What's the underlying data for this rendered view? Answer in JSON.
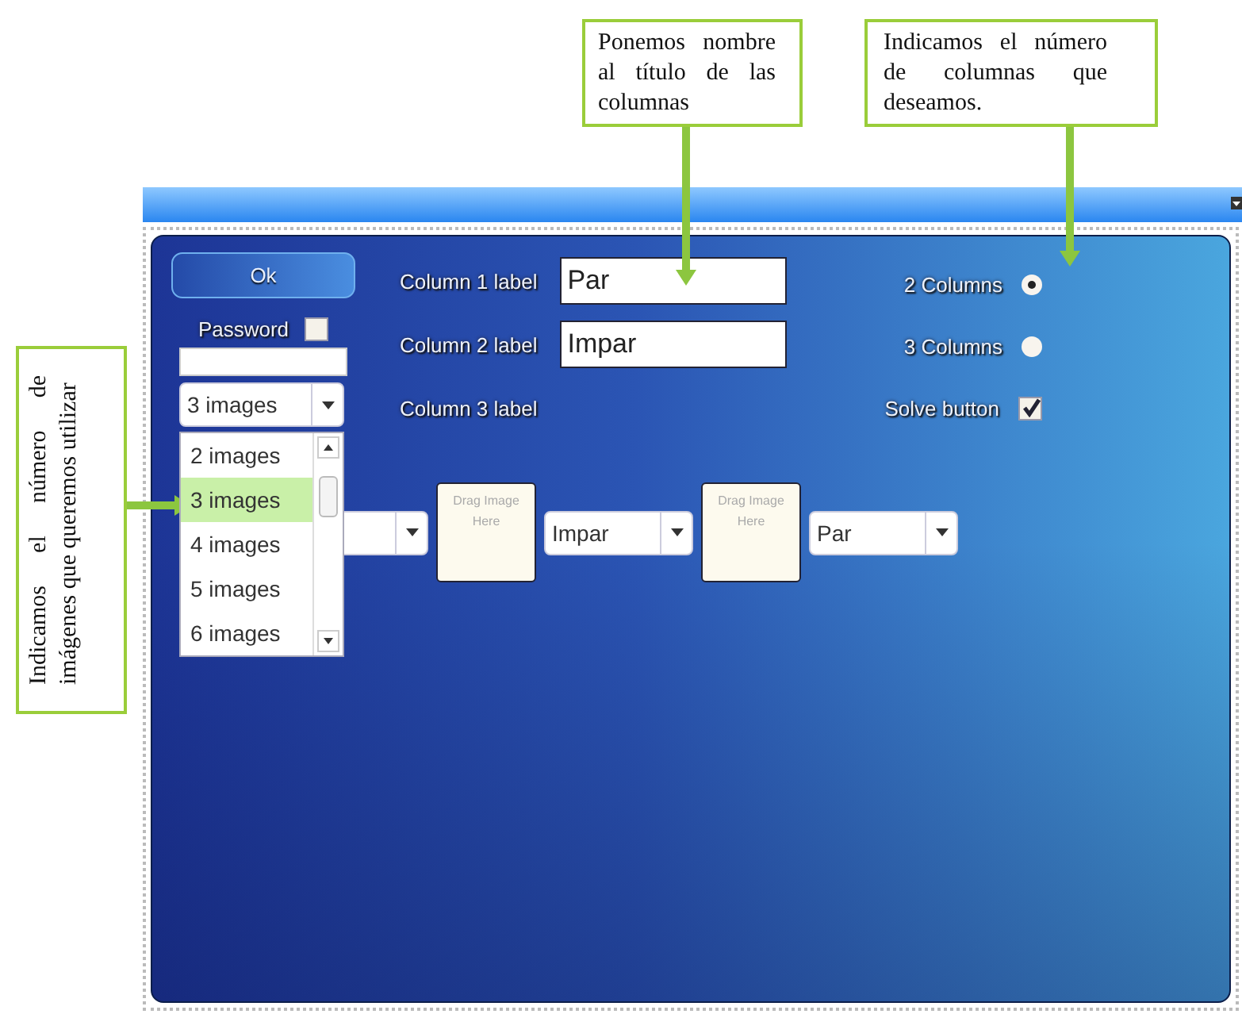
{
  "callouts": [
    {
      "text": "Ponemos nombre al título de las columnas"
    },
    {
      "text": "Indicamos el número de columnas que deseamos."
    },
    {
      "text": "Indicamos el número de imágenes que queremos utilizar"
    }
  ],
  "ok_button": "Ok",
  "password": {
    "label": "Password",
    "checked": false
  },
  "images_select": {
    "value": "3 images",
    "options": [
      {
        "label": "2 images",
        "selected": false
      },
      {
        "label": "3 images",
        "selected": true
      },
      {
        "label": "4 images",
        "selected": false
      },
      {
        "label": "5 images",
        "selected": false
      },
      {
        "label": "6 images",
        "selected": false
      }
    ]
  },
  "column_labels": [
    {
      "label": "Column 1 label",
      "value": "Par"
    },
    {
      "label": "Column 2 label",
      "value": "Impar"
    },
    {
      "label": "Column 3 label"
    }
  ],
  "column_options": [
    {
      "kind": "radio",
      "label": "2 Columns",
      "selected": true
    },
    {
      "kind": "radio",
      "label": "3 Columns",
      "selected": false
    },
    {
      "kind": "checkbox",
      "label": "Solve button",
      "checked": true
    }
  ],
  "pairs": [
    {
      "kind": "select"
    },
    {
      "kind": "drop",
      "text": "Drag Image Here"
    },
    {
      "kind": "select",
      "value": "Impar"
    },
    {
      "kind": "drop",
      "text": "Drag Image Here"
    },
    {
      "kind": "select",
      "value": "Par"
    }
  ]
}
